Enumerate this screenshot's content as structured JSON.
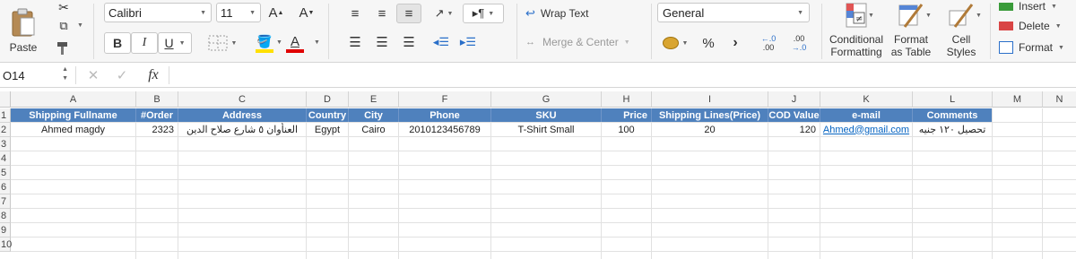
{
  "ribbon": {
    "paste_label": "Paste",
    "font_name": "Calibri",
    "font_size": "11",
    "bold": "B",
    "italic": "I",
    "underline": "U",
    "grow_font": "A",
    "shrink_font": "A",
    "font_color_letter": "A",
    "wrap_text": "Wrap Text",
    "merge_center": "Merge & Center",
    "number_format": "General",
    "percent": "%",
    "comma": "›",
    "inc_decimal_top": "←.0",
    "inc_decimal_bottom": ".00",
    "dec_decimal_top": ".00",
    "dec_decimal_bottom": "→.0",
    "conditional_formatting_line1": "Conditional",
    "conditional_formatting_line2": "Formatting",
    "format_table_line1": "Format",
    "format_table_line2": "as Table",
    "cell_styles_line1": "Cell",
    "cell_styles_line2": "Styles",
    "insert": "Insert",
    "delete": "Delete",
    "format": "Format",
    "fill_color": "#ffe000",
    "font_color": "#e00000"
  },
  "formula_bar": {
    "name_box": "O14",
    "fx": "fx",
    "formula": ""
  },
  "sheet": {
    "columns": [
      "A",
      "B",
      "C",
      "D",
      "E",
      "F",
      "G",
      "H",
      "I",
      "J",
      "K",
      "L",
      "M",
      "N"
    ],
    "row_numbers": [
      "1",
      "2",
      "3",
      "4",
      "5",
      "6",
      "7",
      "8",
      "9",
      "10"
    ],
    "header": [
      "Shipping Fullname",
      "#Order",
      "Address",
      "Country",
      "City",
      "Phone",
      "SKU",
      "Price",
      "Shipping Lines(Price)",
      "COD Value",
      "e-mail",
      "Comments"
    ],
    "row2": [
      "Ahmed magdy",
      "2323",
      "العنأوان ٥ شارع صلاح الدين",
      "Egypt",
      "Cairo",
      "2010123456789",
      "T-Shirt Small",
      "100",
      "20",
      "120",
      "Ahmed@gmail.com",
      "تحصيل ١٢٠ جنيه"
    ],
    "header_color": "#4f81bd",
    "link_color": "#0563c1"
  }
}
